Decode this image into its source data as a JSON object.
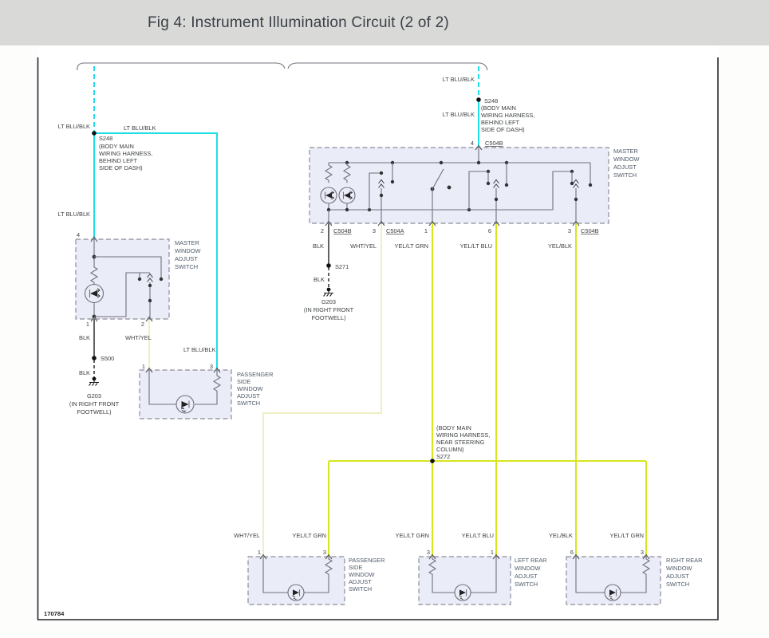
{
  "header": {
    "title": "Fig 4: Instrument Illumination Circuit (2 of 2)"
  },
  "footer": {
    "code": "170784"
  },
  "colors": {
    "cyan": "#1fdfe6",
    "yellow_green": "#d7e51f",
    "pale_yellow": "#efefc4",
    "black_wire": "#1f1f1f",
    "circuit_gray": "#70707c",
    "box_fill": "#eaecf7",
    "header_band": "#d9d9d8"
  },
  "wire_labels": {
    "lt_blu_blk": "LT BLU/BLK",
    "blk": "BLK",
    "wht_yel": "WHT/YEL",
    "yel_lt_grn": "YEL/LT GRN",
    "yel_lt_blu": "YEL/LT BLU",
    "yel_blk": "YEL/BLK"
  },
  "pins": {
    "p1": "1",
    "p2": "2",
    "p3": "3",
    "p4": "4",
    "p6": "6"
  },
  "connectors": {
    "c504a": "C504A",
    "c504b": "C504B"
  },
  "splices": {
    "s248": "S248",
    "s271": "S271",
    "s500": "S500",
    "s272": "S272",
    "s248_note": [
      "(BODY MAIN",
      "WIRING HARNESS,",
      "BEHIND LEFT",
      "SIDE OF DASH)"
    ],
    "s272_note": [
      "(BODY MAIN",
      "WIRING HARNESS,",
      "NEAR STEERING",
      "COLUMN)"
    ]
  },
  "grounds": {
    "g203": "G203",
    "g203_note": [
      "(IN RIGHT FRONT",
      "FOOTWELL)"
    ]
  },
  "components": {
    "master_window_adjust_switch": [
      "MASTER",
      "WINDOW",
      "ADJUST",
      "SWITCH"
    ],
    "passenger_side_window_adjust_switch": [
      "PASSENGER",
      "SIDE",
      "WINDOW",
      "ADJUST",
      "SWITCH"
    ],
    "left_rear_window_adjust_switch": [
      "LEFT REAR",
      "WINDOW",
      "ADJUST",
      "SWITCH"
    ],
    "right_rear_window_adjust_switch": [
      "RIGHT REAR",
      "WINDOW",
      "ADJUST",
      "SWITCH"
    ]
  }
}
